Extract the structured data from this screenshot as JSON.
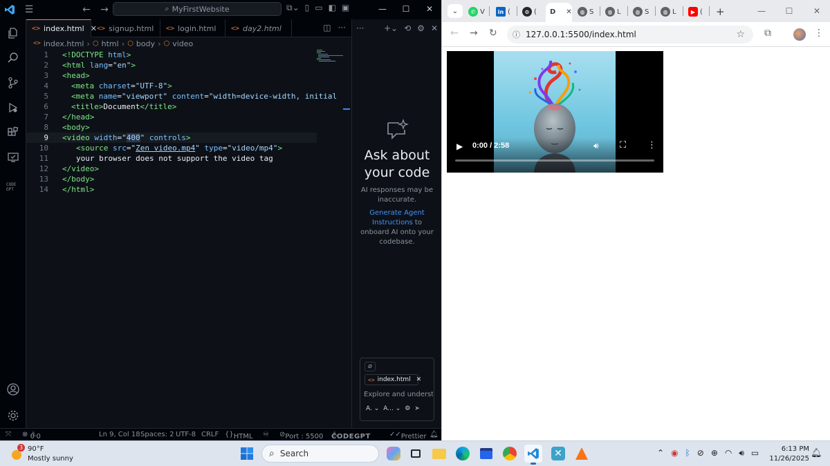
{
  "vscode": {
    "search": "MyFirstWebsite",
    "tabs": [
      {
        "label": "index.html",
        "active": true
      },
      {
        "label": "signup.html"
      },
      {
        "label": "login.html"
      },
      {
        "label": "day2.html",
        "italic": true
      }
    ],
    "breadcrumb": [
      "index.html",
      "html",
      "body",
      "video"
    ],
    "code_lines": [
      {
        "n": "1"
      },
      {
        "n": "2"
      },
      {
        "n": "3"
      },
      {
        "n": "4"
      },
      {
        "n": "5"
      },
      {
        "n": "6"
      },
      {
        "n": "7"
      },
      {
        "n": "8"
      },
      {
        "n": "9"
      },
      {
        "n": "10"
      },
      {
        "n": "11"
      },
      {
        "n": "12"
      },
      {
        "n": "13"
      },
      {
        "n": "14"
      }
    ],
    "code": {
      "l1": [
        "<!DOCTYPE ",
        "html",
        ">"
      ],
      "l2": [
        "<html ",
        "lang",
        "=",
        "\"en\"",
        ">"
      ],
      "l3": "<head>",
      "l4": [
        "<meta ",
        "charset",
        "=",
        "\"UTF-8\"",
        ">"
      ],
      "l5": [
        "<meta ",
        "name",
        "=",
        "\"viewport\"",
        " content",
        "=",
        "\"width=device-width, initial"
      ],
      "l6": [
        "<title>",
        "Document",
        "</title>"
      ],
      "l7": "</head>",
      "l8": "<body>",
      "l9": [
        "<video ",
        "width",
        "=",
        "\"",
        "400",
        "\"",
        " controls",
        ">"
      ],
      "l10": [
        "<source ",
        "src",
        "=",
        "\"",
        "Zen video.mp4",
        "\"",
        " type",
        "=",
        "\"video/mp4\"",
        ">"
      ],
      "l11": "your browser does not support the video tag",
      "l12": "</video>",
      "l13": "</body>",
      "l14": "</html>"
    },
    "chat": {
      "heading": "Ask about your code",
      "disclaimer": "AI responses may be inaccurate.",
      "onboard_link": "Generate Agent Instructions",
      "onboard_rest": " to onboard AI onto your codebase.",
      "chip": "index.html",
      "placeholder": "Explore and understa",
      "agent_label": "A.",
      "model_label": "A..."
    },
    "status": {
      "problems_errors": "0",
      "problems_warnings": "0",
      "position": "Ln 9, Col 18",
      "spaces": "Spaces: 2",
      "encoding": "UTF-8",
      "eol": "CRLF",
      "language": "HTML",
      "port": "Port : 5500",
      "codegpt": "CODEGPT",
      "prettier": "Prettier"
    }
  },
  "chrome": {
    "tab_letters": [
      "V",
      "(",
      "(",
      "D",
      "S",
      "L",
      "S",
      "L",
      "("
    ],
    "url": "127.0.0.1:5500/index.html",
    "video": {
      "time": "0:00 / 2:58",
      "progress": 0
    }
  },
  "taskbar": {
    "weather_temp": "90°F",
    "weather_cond": "Mostly sunny",
    "weather_badge": "3",
    "search": "Search",
    "time": "6:13 PM",
    "date": "11/26/2025"
  },
  "colors": {
    "vscode_bg": "#0d1117",
    "accent_blue": "#4493f8",
    "html_icon": "#e37933"
  }
}
